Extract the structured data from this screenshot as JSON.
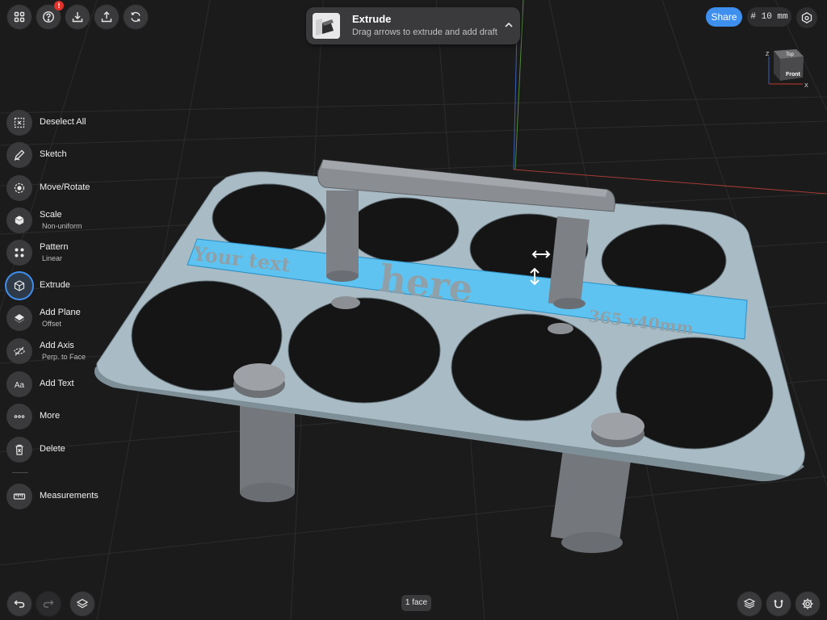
{
  "top_bar": {
    "left_buttons": [
      {
        "icon": "grid-icon",
        "badge": ""
      },
      {
        "icon": "help-icon",
        "badge": "!"
      },
      {
        "icon": "import-icon",
        "badge": ""
      },
      {
        "icon": "export-icon",
        "badge": ""
      },
      {
        "icon": "sync-icon",
        "badge": ""
      }
    ],
    "share_label": "Share",
    "grid_size": "# 10 mm"
  },
  "tool_banner": {
    "title": "Extrude",
    "subtitle": "Drag arrows to extrude and add draft"
  },
  "view_cube": {
    "top_label": "Top",
    "front_label": "Front",
    "axis_x": "X",
    "axis_z": "Z"
  },
  "tools": [
    {
      "name": "deselect-all",
      "label": "Deselect All",
      "sub": "",
      "icon": "deselect-icon",
      "active": false
    },
    {
      "name": "sketch",
      "label": "Sketch",
      "sub": "",
      "icon": "pencil-icon",
      "active": false
    },
    {
      "name": "move-rotate",
      "label": "Move/Rotate",
      "sub": "",
      "icon": "move-rotate-icon",
      "active": false
    },
    {
      "name": "scale",
      "label": "Scale",
      "sub": "Non-uniform",
      "icon": "scale-icon",
      "active": false
    },
    {
      "name": "pattern",
      "label": "Pattern",
      "sub": "Linear",
      "icon": "pattern-icon",
      "active": false
    },
    {
      "name": "extrude",
      "label": "Extrude",
      "sub": "",
      "icon": "extrude-icon",
      "active": true
    },
    {
      "name": "add-plane",
      "label": "Add Plane",
      "sub": "Offset",
      "icon": "plane-icon",
      "active": false
    },
    {
      "name": "add-axis",
      "label": "Add Axis",
      "sub": "Perp. to Face",
      "icon": "axis-icon",
      "active": false
    },
    {
      "name": "add-text",
      "label": "Add Text",
      "sub": "",
      "icon": "text-icon",
      "active": false
    },
    {
      "name": "more",
      "label": "More",
      "sub": "",
      "icon": "more-icon",
      "active": false
    },
    {
      "name": "delete",
      "label": "Delete",
      "sub": "",
      "icon": "trash-icon",
      "active": false
    }
  ],
  "measurements_label": "Measurements",
  "model": {
    "text_line1": "Your text",
    "text_line2": "here",
    "text_size": "365 x40mm"
  },
  "status": {
    "selection": "1 face"
  },
  "colors": {
    "accent": "#3f8fef",
    "selected_face": "#5ec3f0",
    "plate": "#a9bcc6",
    "background": "#1b1b1c",
    "badge": "#e5312b"
  }
}
